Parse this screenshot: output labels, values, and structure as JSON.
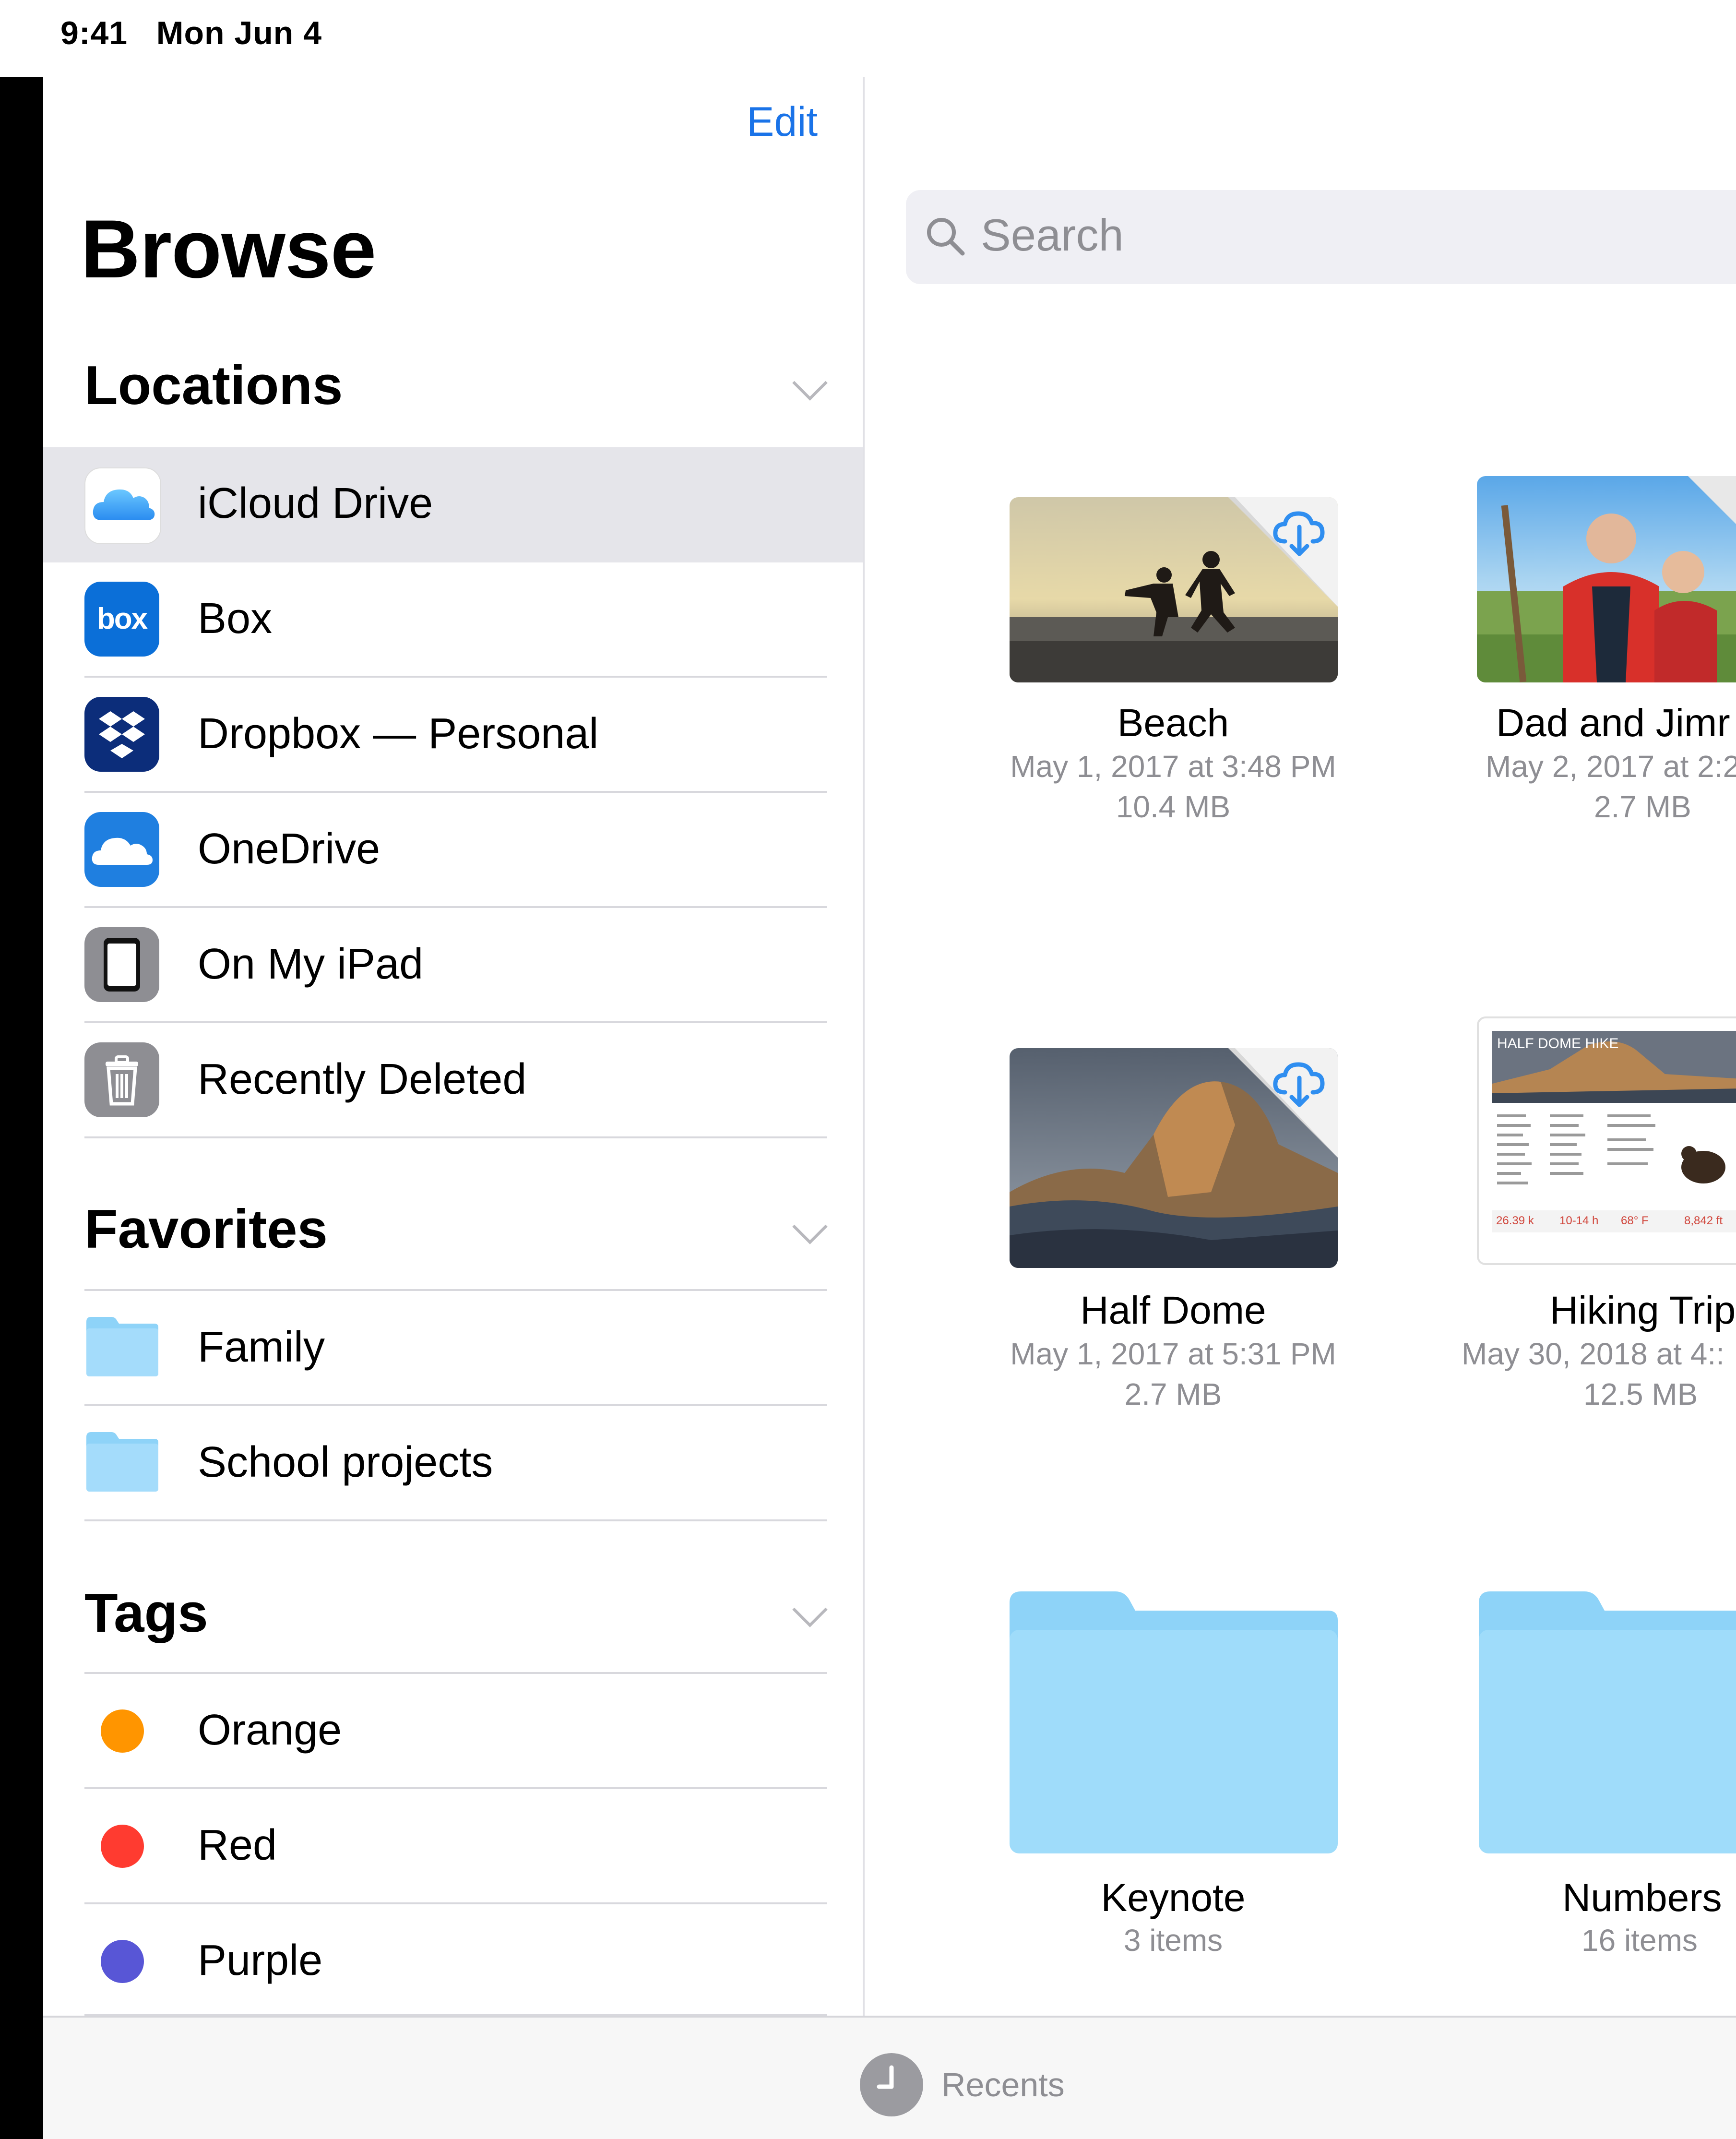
{
  "status_bar": {
    "time": "9:41",
    "date": "Mon Jun 4"
  },
  "sidebar": {
    "edit_label": "Edit",
    "title": "Browse",
    "locations": {
      "header": "Locations",
      "items": [
        {
          "label": "iCloud Drive",
          "icon": "icloud-icon",
          "selected": true
        },
        {
          "label": "Box",
          "icon": "box-icon",
          "icon_text": "box"
        },
        {
          "label": "Dropbox — Personal",
          "icon": "dropbox-icon"
        },
        {
          "label": "OneDrive",
          "icon": "onedrive-icon"
        },
        {
          "label": "On My iPad",
          "icon": "ipad-icon"
        },
        {
          "label": "Recently Deleted",
          "icon": "trash-icon"
        }
      ]
    },
    "favorites": {
      "header": "Favorites",
      "items": [
        {
          "label": "Family",
          "icon": "folder-icon"
        },
        {
          "label": "School projects",
          "icon": "folder-icon"
        }
      ]
    },
    "tags": {
      "header": "Tags",
      "items": [
        {
          "label": "Orange",
          "color": "#FF9500"
        },
        {
          "label": "Red",
          "color": "#FF3B30"
        },
        {
          "label": "Purple",
          "color": "#5856D6"
        }
      ]
    }
  },
  "search": {
    "placeholder": "Search"
  },
  "files": [
    {
      "name": "Beach",
      "date": "May 1, 2017 at 3:48 PM",
      "size": "10.4 MB",
      "cloud": true
    },
    {
      "name": "Dad and Jimr",
      "date": "May 2, 2017 at 2:2",
      "size": "2.7 MB"
    },
    {
      "name": "Half Dome",
      "date": "May 1, 2017 at 5:31 PM",
      "size": "2.7 MB",
      "cloud": true
    },
    {
      "name": "Hiking Trip",
      "date": "May 30, 2018 at 4::",
      "size": "12.5 MB",
      "doc_title": "HALF DOME HIKE",
      "doc_stats": [
        "26.39 k",
        "10-14 h",
        "68° F",
        "8,842 ft"
      ]
    },
    {
      "name": "Keynote",
      "count": "3 items"
    },
    {
      "name": "Numbers",
      "count": "16 items"
    }
  ],
  "tab_bar": {
    "recents_label": "Recents"
  },
  "colors": {
    "accent": "#1A73E8",
    "folder": "#8ED3F8",
    "selected_row": "#E5E5EA"
  }
}
